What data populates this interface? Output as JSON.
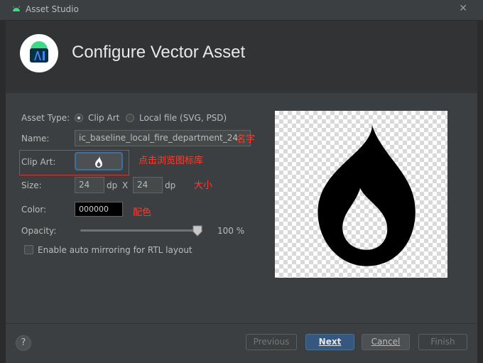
{
  "window": {
    "title": "Asset Studio",
    "close_glyph": "✕"
  },
  "header": {
    "title": "Configure Vector Asset",
    "logo_icon": "android-studio-icon"
  },
  "form": {
    "asset_type_label": "Asset Type:",
    "asset_type_options": [
      "Clip Art",
      "Local file (SVG, PSD)"
    ],
    "asset_type_selected": "Clip Art",
    "name_label": "Name:",
    "name_value": "ic_baseline_local_fire_department_24",
    "clip_art_label": "Clip Art:",
    "clip_art_icon": "fire-icon",
    "size_label": "Size:",
    "width_value": "24",
    "height_value": "24",
    "size_unit": "dp",
    "size_separator": "X",
    "color_label": "Color:",
    "color_value": "000000",
    "opacity_label": "Opacity:",
    "opacity_percent": 100,
    "opacity_text": "100 %",
    "rtl_label": "Enable auto mirroring for RTL layout",
    "rtl_checked": false
  },
  "annotations": {
    "name_note": "名字",
    "clip_note": "点击浏览图标库",
    "size_note": "大小",
    "color_note": "配色"
  },
  "preview": {
    "icon": "local-fire-department-icon"
  },
  "footer": {
    "help": "?",
    "previous": "Previous",
    "next": "Next",
    "cancel": "Cancel",
    "finish": "Finish"
  },
  "colors": {
    "background": "#3c3f41",
    "header": "#313335",
    "accent": "#365880",
    "annotation": "#ff3b30"
  }
}
